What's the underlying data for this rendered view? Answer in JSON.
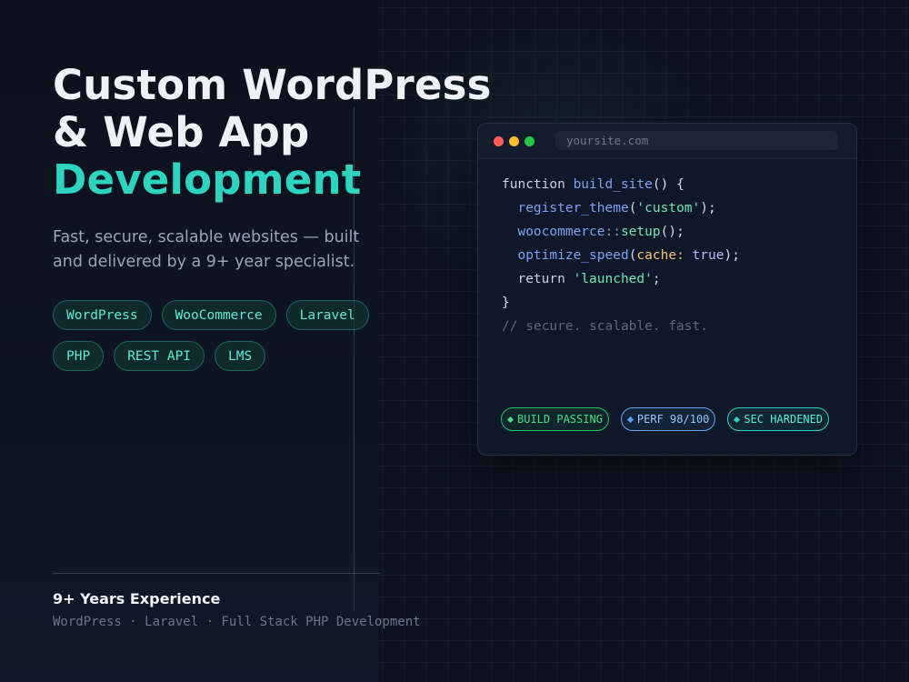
{
  "hero": {
    "title_line1": "Custom WordPress",
    "title_line2": "& Web App",
    "title_accent": "Development",
    "subtitle": "Fast, secure, scalable websites — built and delivered by a 9+ year specialist."
  },
  "tags": [
    "WordPress",
    "WooCommerce",
    "Laravel",
    "PHP",
    "REST API",
    "LMS"
  ],
  "code_window": {
    "url": "yoursite.com",
    "code": {
      "l1_kw": "function ",
      "l1_fn": "build_site",
      "l1_rest": "() {",
      "l2_indent": "  ",
      "l2_fn": "register_theme",
      "l2_open": "(",
      "l2_str": "'custom'",
      "l2_close": ");",
      "l3_indent": "  ",
      "l3_ns": "woocommerce",
      "l3_op": "::",
      "l3_fn": "setup",
      "l3_rest": "();",
      "l4_indent": "  ",
      "l4_fn": "optimize_speed",
      "l4_open": "(",
      "l4_param": "cache:",
      "l4_lit": " true",
      "l4_close": ");",
      "l5_indent": "  ",
      "l5_kw": "return ",
      "l5_str": "'launched'",
      "l5_close": ";",
      "l6": "}",
      "l7_comment": "// secure. scalable. fast."
    },
    "badges": [
      {
        "label": "BUILD PASSING",
        "color": "#22c55e"
      },
      {
        "label": "PERF 98/100",
        "color": "#60a5fa"
      },
      {
        "label": "SEC HARDENED",
        "color": "#2dd4bf"
      }
    ]
  },
  "footer": {
    "title": "9+ Years Experience",
    "subtitle": "WordPress · Laravel · Full Stack PHP Development"
  },
  "colors": {
    "background": "#0c121d",
    "accent": "#2dd4bf",
    "text": "#eef2f7",
    "muted": "#9aa4b6"
  }
}
